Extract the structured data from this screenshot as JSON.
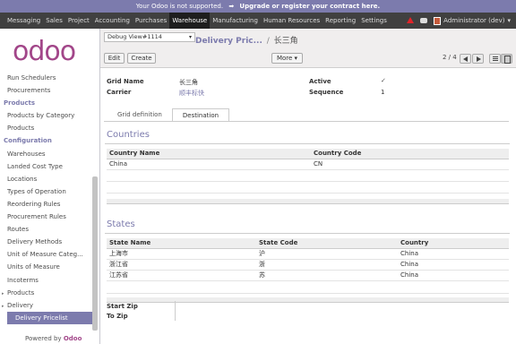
{
  "notice": {
    "text": "Your Odoo is not supported.",
    "arrow": "➡",
    "link": "Upgrade or register your contract here."
  },
  "topmenu": {
    "items": [
      "Messaging",
      "Sales",
      "Project",
      "Accounting",
      "Purchases",
      "Warehouse",
      "Manufacturing",
      "Human Resources",
      "Reporting",
      "Settings"
    ],
    "active": "Warehouse",
    "user": "Administrator (dev)",
    "user_caret": "▾"
  },
  "sidebar": {
    "logo_main": "odoo",
    "items": [
      {
        "label": "Run Schedulers",
        "kind": "item"
      },
      {
        "label": "Procurements",
        "kind": "item"
      },
      {
        "label": "Products",
        "kind": "header"
      },
      {
        "label": "Products by Category",
        "kind": "item"
      },
      {
        "label": "Products",
        "kind": "item"
      },
      {
        "label": "Configuration",
        "kind": "header"
      },
      {
        "label": "Warehouses",
        "kind": "item"
      },
      {
        "label": "Landed Cost Type",
        "kind": "item"
      },
      {
        "label": "Locations",
        "kind": "item"
      },
      {
        "label": "Types of Operation",
        "kind": "item"
      },
      {
        "label": "Reordering Rules",
        "kind": "item"
      },
      {
        "label": "Procurement Rules",
        "kind": "item"
      },
      {
        "label": "Routes",
        "kind": "item"
      },
      {
        "label": "Delivery Methods",
        "kind": "item"
      },
      {
        "label": "Unit of Measure Categ...",
        "kind": "item"
      },
      {
        "label": "Units of Measure",
        "kind": "item"
      },
      {
        "label": "Incoterms",
        "kind": "item"
      },
      {
        "label": "Products",
        "kind": "expander"
      },
      {
        "label": "Delivery",
        "kind": "expander"
      },
      {
        "label": "Delivery Pricelist",
        "kind": "selected"
      }
    ],
    "powered_prefix": "Powered by",
    "powered_brand": "Odoo"
  },
  "header": {
    "debug": "Debug View#1114",
    "debug_caret": "▾",
    "breadcrumb_link": "Delivery Pric...",
    "breadcrumb_sep": "/",
    "breadcrumb_current": "长三角",
    "edit": "Edit",
    "create": "Create",
    "more": "More ▾",
    "pager": "2 / 4"
  },
  "form": {
    "grid_name_label": "Grid Name",
    "grid_name_value": "长三角",
    "carrier_label": "Carrier",
    "carrier_value": "顺丰标快",
    "active_label": "Active",
    "active_value": "✓",
    "sequence_label": "Sequence",
    "sequence_value": "1",
    "tabs": [
      "Grid definition",
      "Destination"
    ],
    "active_tab": "Destination",
    "countries": {
      "title": "Countries",
      "columns": [
        "Country Name",
        "Country Code"
      ],
      "rows": [
        [
          "China",
          "CN"
        ]
      ]
    },
    "states": {
      "title": "States",
      "columns": [
        "State Name",
        "State Code",
        "Country"
      ],
      "rows": [
        [
          "上海市",
          "沪",
          "China"
        ],
        [
          "浙江省",
          "浙",
          "China"
        ],
        [
          "江苏省",
          "苏",
          "China"
        ]
      ]
    },
    "start_zip_label": "Start Zip",
    "to_zip_label": "To Zip"
  }
}
